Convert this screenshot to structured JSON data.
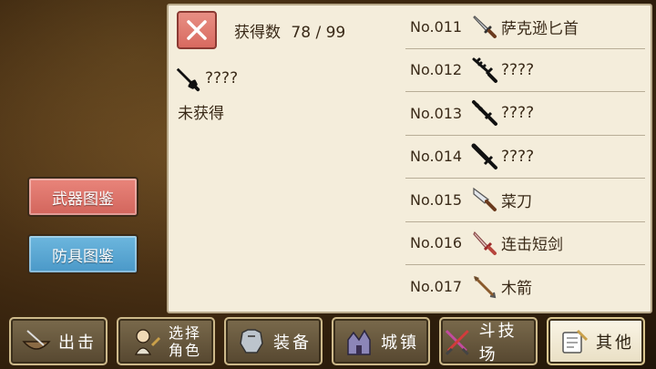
{
  "categories": {
    "weapon_label": "武器图鉴",
    "armor_label": "防具图鉴"
  },
  "detail": {
    "count_label": "获得数",
    "count_value": "78 / 99",
    "name": "????",
    "status": "未获得"
  },
  "list": [
    {
      "no": "No.011",
      "name": "萨克逊匕首",
      "icon": "saxon-dagger-icon",
      "obtained": true
    },
    {
      "no": "No.012",
      "name": "????",
      "icon": "unknown-weapon-icon",
      "obtained": false
    },
    {
      "no": "No.013",
      "name": "????",
      "icon": "unknown-weapon-icon",
      "obtained": false
    },
    {
      "no": "No.014",
      "name": "????",
      "icon": "unknown-weapon-icon",
      "obtained": false
    },
    {
      "no": "No.015",
      "name": "菜刀",
      "icon": "kitchen-knife-icon",
      "obtained": true
    },
    {
      "no": "No.016",
      "name": "连击短剑",
      "icon": "combo-short-sword-icon",
      "obtained": true
    },
    {
      "no": "No.017",
      "name": "木箭",
      "icon": "wooden-arrow-icon",
      "obtained": true
    }
  ],
  "nav": {
    "sortie": "出击",
    "choose_line1": "选择",
    "choose_line2": "角色",
    "equip": "装备",
    "town": "城镇",
    "arena": "斗技场",
    "other": "其他"
  },
  "colors": {
    "panel_bg": "#f4eddb",
    "weapon_btn": "#d86a60",
    "armor_btn": "#4a98c8",
    "nav_bg": "#564730"
  }
}
